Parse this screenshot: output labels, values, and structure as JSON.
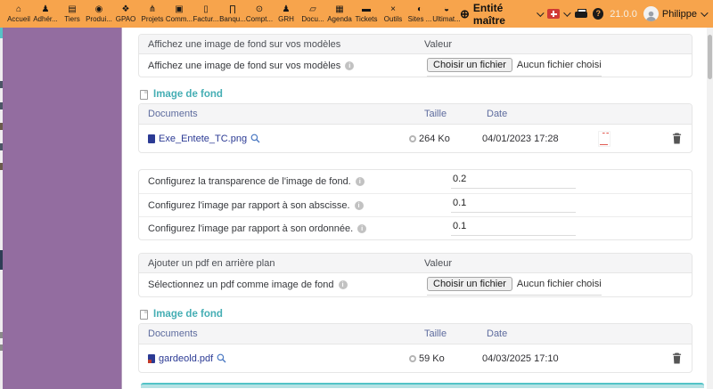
{
  "colors": {
    "topbar_orange": "#f7a44c",
    "panel_purple": "#936da0",
    "heading_teal": "#45aeb4",
    "link_navy": "#2b3a94",
    "column_slate": "#5e6c9e",
    "bottom_bar_teal": "#53c3c7"
  },
  "topbar": {
    "nav": [
      {
        "label": "Accueil",
        "glyph": "⌂"
      },
      {
        "label": "Adhér...",
        "glyph": "♟"
      },
      {
        "label": "Tiers",
        "glyph": "▤"
      },
      {
        "label": "Produi...",
        "glyph": "◉"
      },
      {
        "label": "GPAO",
        "glyph": "❖"
      },
      {
        "label": "Projets",
        "glyph": "⋔"
      },
      {
        "label": "Comm...",
        "glyph": "▣"
      },
      {
        "label": "Factur...",
        "glyph": "▯"
      },
      {
        "label": "Banqu...",
        "glyph": "∏"
      },
      {
        "label": "Compt...",
        "glyph": "⊙"
      },
      {
        "label": "GRH",
        "glyph": "♟"
      },
      {
        "label": "Docu...",
        "glyph": "▱"
      },
      {
        "label": "Agenda",
        "glyph": "▦"
      },
      {
        "label": "Tickets",
        "glyph": "▬"
      },
      {
        "label": "Outils",
        "glyph": "×"
      },
      {
        "label": "Sites ...",
        "glyph": "◐"
      },
      {
        "label": "Ultimat...",
        "glyph": "◒"
      }
    ],
    "entity_label": "Entité maître",
    "version": "21.0.0",
    "user_name": "Philippe"
  },
  "model_image_section": {
    "header": "Affichez une image de fond sur vos modèles",
    "value_header": "Valeur",
    "row_label": "Affichez une image de fond sur vos modèles",
    "file_button": "Choisir un fichier",
    "file_status": "Aucun fichier choisi"
  },
  "documents_table_1": {
    "title": "Image de fond",
    "col_documents": "Documents",
    "col_taille": "Taille",
    "col_date": "Date",
    "row": {
      "name": "Exe_Entete_TC.png",
      "size": "264 Ko",
      "date": "04/01/2023 17:28"
    }
  },
  "image_settings": {
    "rows": [
      {
        "label": "Configurez la transparence de l'image de fond.",
        "value": "0.2"
      },
      {
        "label": "Configurez l'image par rapport à son abscisse.",
        "value": "0.1"
      },
      {
        "label": "Configurez l'image par rapport à son ordonnée.",
        "value": "0.1"
      }
    ]
  },
  "pdf_section": {
    "header": "Ajouter un pdf en arrière plan",
    "value_header": "Valeur",
    "row_label": "Sélectionnez un pdf comme image de fond",
    "file_button": "Choisir un fichier",
    "file_status": "Aucun fichier choisi"
  },
  "documents_table_2": {
    "title": "Image de fond",
    "col_documents": "Documents",
    "col_taille": "Taille",
    "col_date": "Date",
    "row": {
      "name": "gardeold.pdf",
      "size": "59 Ko",
      "date": "04/03/2025 17:10"
    }
  }
}
